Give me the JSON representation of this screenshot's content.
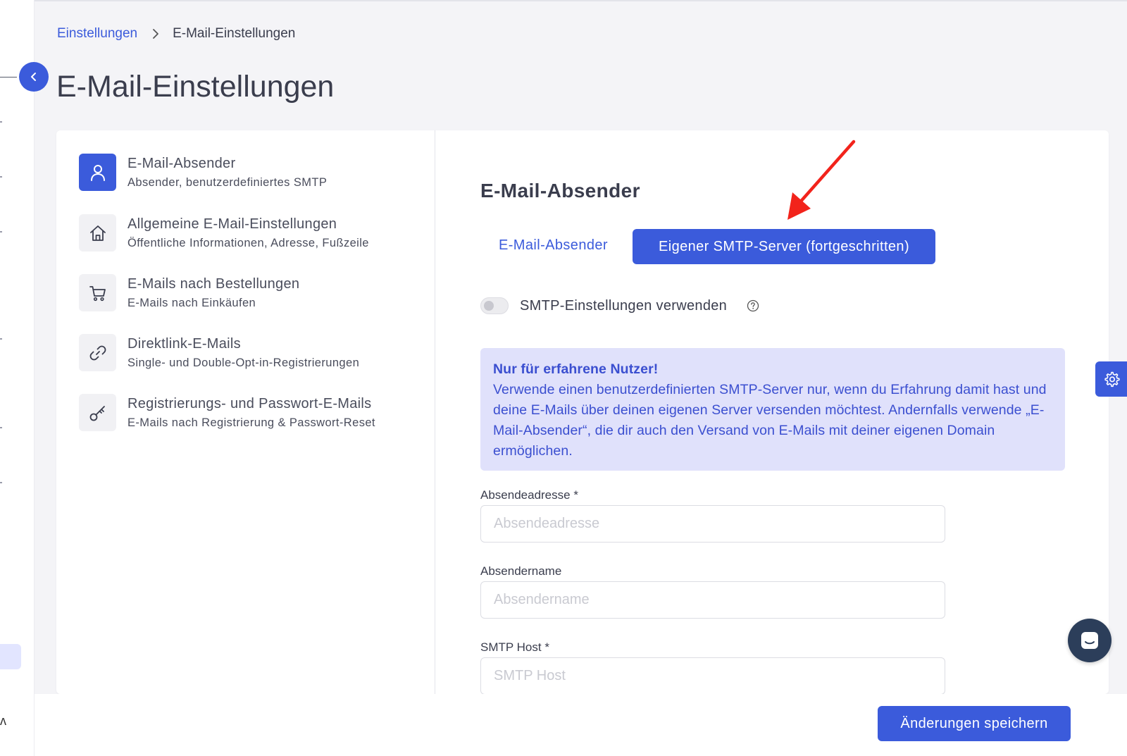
{
  "breadcrumb": {
    "parent": "Einstellungen",
    "current": "E-Mail-Einstellungen"
  },
  "page": {
    "title": "E-Mail-Einstellungen"
  },
  "menu": {
    "items": [
      {
        "title": "E-Mail-Absender",
        "subtitle": "Absender, benutzerdefiniertes SMTP",
        "icon": "user-icon",
        "active": true
      },
      {
        "title": "Allgemeine E-Mail-Einstellungen",
        "subtitle": "Öffentliche Informationen, Adresse, Fußzeile",
        "icon": "home-icon",
        "active": false
      },
      {
        "title": "E-Mails nach Bestellungen",
        "subtitle": "E-Mails nach Einkäufen",
        "icon": "cart-icon",
        "active": false
      },
      {
        "title": "Direktlink-E-Mails",
        "subtitle": "Single- und Double-Opt-in-Registrierungen",
        "icon": "link-icon",
        "active": false
      },
      {
        "title": "Registrierungs- und Passwort-E-Mails",
        "subtitle": "E-Mails nach Registrierung & Passwort-Reset",
        "icon": "key-icon",
        "active": false
      }
    ]
  },
  "section": {
    "title": "E-Mail-Absender",
    "tabs": [
      {
        "label": "E-Mail-Absender",
        "active": false
      },
      {
        "label": "Eigener SMTP-Server (fortgeschritten)",
        "active": true
      }
    ]
  },
  "smtp_toggle": {
    "label": "SMTP-Einstellungen verwenden",
    "enabled": false
  },
  "info_box": {
    "title": "Nur für erfahrene Nutzer!",
    "body": "Verwende einen benutzerdefinierten SMTP-Server nur, wenn du Erfahrung damit hast und deine E-Mails über deinen eigenen Server versenden möchtest. Andernfalls verwende „E-Mail-Absender“, die dir auch den Versand von E-Mails mit deiner eigenen Domain ermöglichen."
  },
  "form": {
    "sender_address": {
      "label": "Absendeadresse *",
      "placeholder": "Absendeadresse",
      "value": ""
    },
    "sender_name": {
      "label": "Absendername",
      "placeholder": "Absendername",
      "value": ""
    },
    "smtp_host": {
      "label": "SMTP Host *",
      "placeholder": "SMTP Host",
      "value": ""
    }
  },
  "footer": {
    "save_label": "Änderungen speichern"
  },
  "colors": {
    "accent": "#3b5bdb",
    "info_background": "#e0e1fb",
    "annotation_arrow": "#f2231b"
  }
}
